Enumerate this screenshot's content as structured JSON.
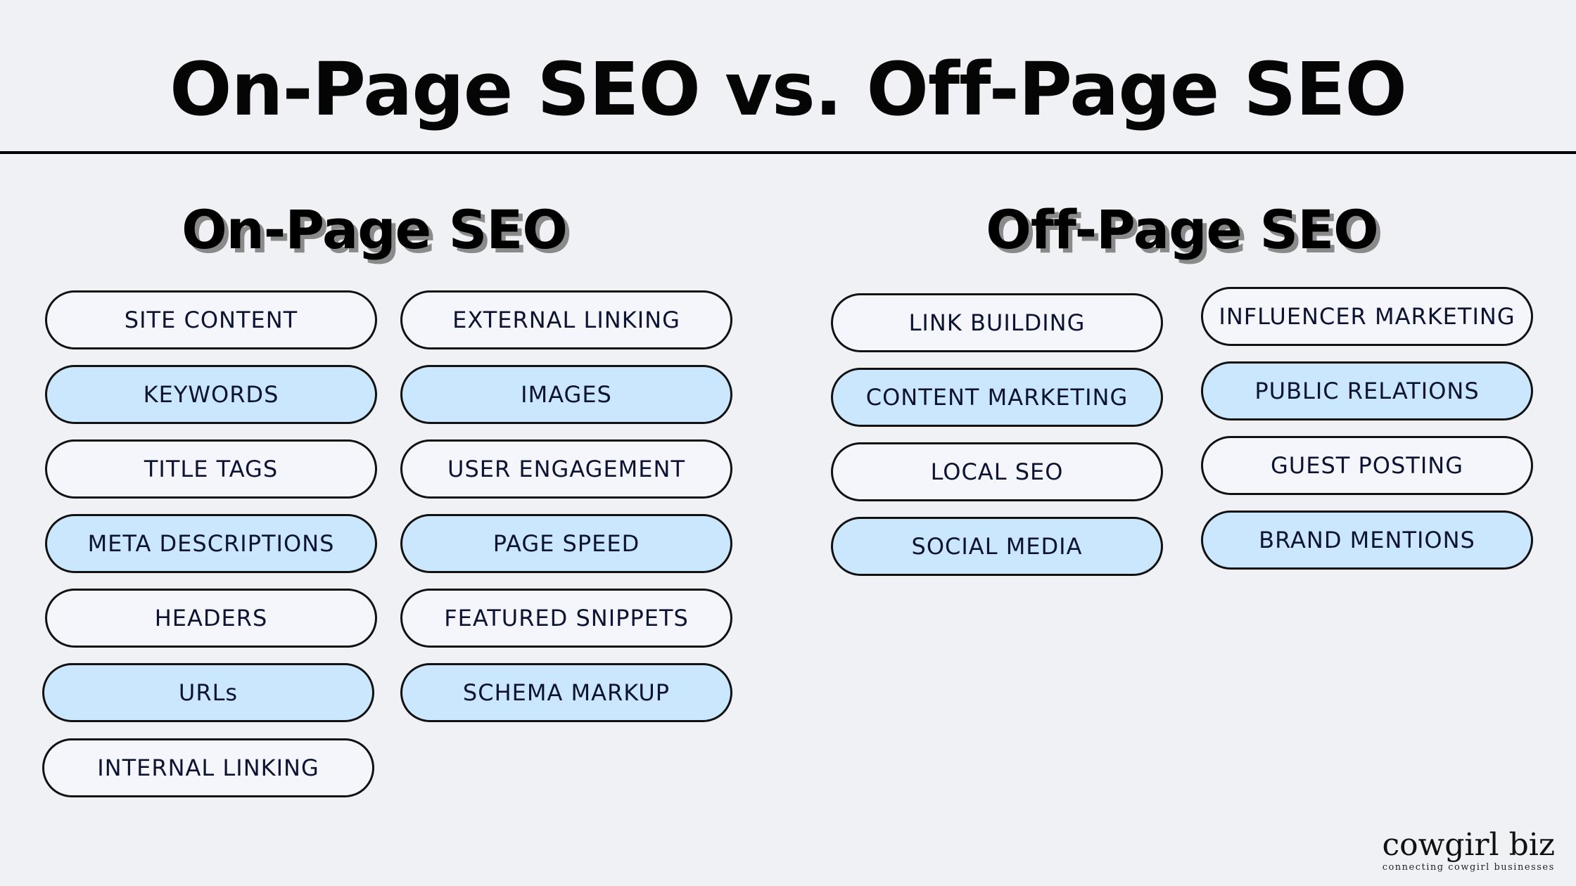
{
  "title": "On-Page SEO vs. Off-Page SEO",
  "on_page": {
    "heading": "On-Page SEO",
    "column_1": [
      {
        "label": "SITE CONTENT",
        "style": "white"
      },
      {
        "label": "KEYWORDS",
        "style": "blue"
      },
      {
        "label": "TITLE TAGS",
        "style": "white"
      },
      {
        "label": "META DESCRIPTIONS",
        "style": "blue"
      },
      {
        "label": "HEADERS",
        "style": "white"
      },
      {
        "label": "URLs",
        "style": "blue"
      },
      {
        "label": "INTERNAL LINKING",
        "style": "white"
      }
    ],
    "column_2": [
      {
        "label": "EXTERNAL LINKING",
        "style": "white"
      },
      {
        "label": "IMAGES",
        "style": "blue"
      },
      {
        "label": "USER ENGAGEMENT",
        "style": "white"
      },
      {
        "label": "PAGE SPEED",
        "style": "blue"
      },
      {
        "label": "FEATURED SNIPPETS",
        "style": "white"
      },
      {
        "label": "SCHEMA MARKUP",
        "style": "blue"
      }
    ]
  },
  "off_page": {
    "heading": "Off-Page SEO",
    "column_1": [
      {
        "label": "LINK BUILDING",
        "style": "white"
      },
      {
        "label": "CONTENT MARKETING",
        "style": "blue"
      },
      {
        "label": "LOCAL SEO",
        "style": "white"
      },
      {
        "label": "SOCIAL MEDIA",
        "style": "blue"
      }
    ],
    "column_2": [
      {
        "label": "INFLUENCER MARKETING",
        "style": "white"
      },
      {
        "label": "PUBLIC RELATIONS",
        "style": "blue"
      },
      {
        "label": "GUEST POSTING",
        "style": "white"
      },
      {
        "label": "BRAND MENTIONS",
        "style": "blue"
      }
    ]
  },
  "logo": {
    "name": "cowgirl biz",
    "tagline": "connecting cowgirl businesses"
  },
  "colors": {
    "background": "#eff1f5",
    "pill_white": "#f4f6fb",
    "pill_blue": "#cbe7fd",
    "pill_text": "#0d1433"
  }
}
